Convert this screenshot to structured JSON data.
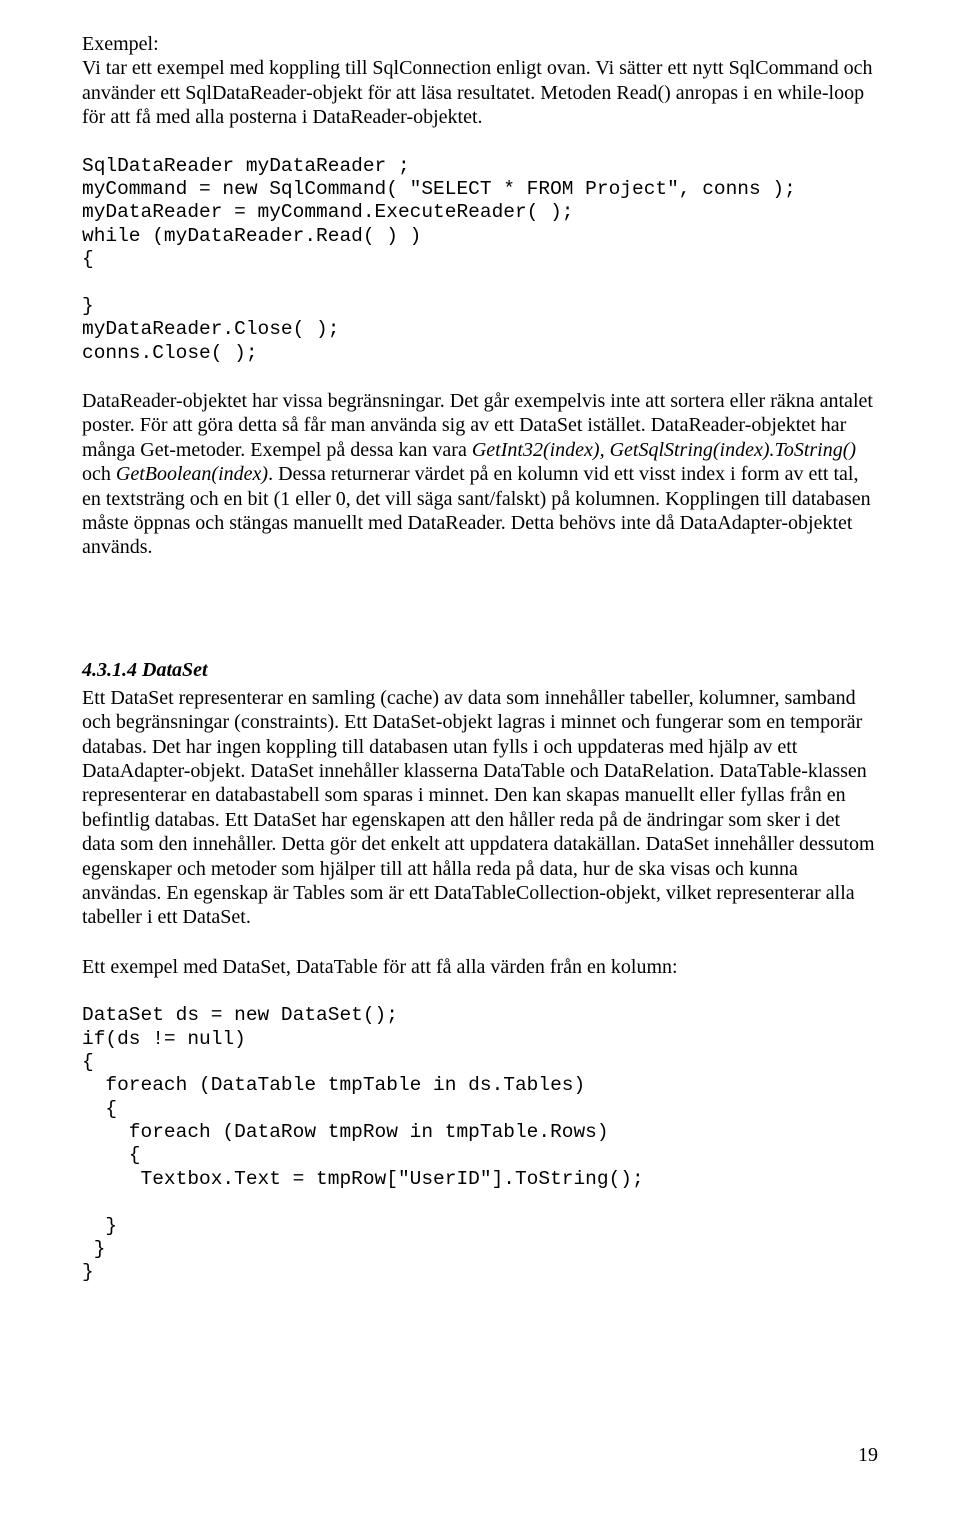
{
  "p1_label": "Exempel:",
  "p1_body": "Vi tar ett exempel med koppling till SqlConnection enligt ovan. Vi sätter ett nytt SqlCommand och använder ett SqlDataReader-objekt för att läsa resultatet. Metoden Read() anropas i en while-loop för att få med alla posterna i DataReader-objektet.",
  "code1": "SqlDataReader myDataReader ;\nmyCommand = new SqlCommand( \"SELECT * FROM Project\", conns );\nmyDataReader = myCommand.ExecuteReader( );\nwhile (myDataReader.Read( ) )\n{\n\n}\nmyDataReader.Close( );\nconns.Close( );",
  "p2_a": "DataReader-objektet har vissa begränsningar. Det går exempelvis inte att sortera eller räkna antalet poster. För att göra detta så får man använda sig av ett DataSet istället. DataReader-objektet har många Get-metoder. Exempel på dessa kan vara ",
  "p2_i1": "GetInt32(index), GetSqlString(index).ToString()",
  "p2_b": " och ",
  "p2_i2": "GetBoolean(index)",
  "p2_c": ". Dessa returnerar värdet på en kolumn vid ett visst index i form av ett tal, en textsträng och en bit (1 eller 0, det vill säga sant/falskt) på kolumnen. Kopplingen till databasen måste öppnas och stängas manuellt med DataReader. Detta behövs inte då DataAdapter-objektet används.",
  "h1": "4.3.1.4   DataSet",
  "p3": "Ett DataSet representerar en samling (cache) av data som innehåller tabeller, kolumner, samband och begränsningar (constraints). Ett DataSet-objekt lagras i minnet och fungerar som en temporär databas. Det har ingen koppling till databasen utan fylls i och uppdateras med hjälp av ett DataAdapter-objekt. DataSet innehåller klasserna DataTable och DataRelation. DataTable-klassen representerar en databastabell som sparas i minnet. Den kan skapas manuellt eller fyllas från en befintlig databas. Ett DataSet har egenskapen att den håller reda på de ändringar som sker i det data som den innehåller. Detta gör det enkelt att uppdatera datakällan. DataSet innehåller dessutom egenskaper och metoder som hjälper till att hålla reda på data, hur de ska visas och kunna användas. En egenskap är Tables som är ett DataTableCollection-objekt, vilket representerar alla tabeller i ett DataSet.",
  "p4": "Ett exempel med DataSet, DataTable för att få alla värden från en kolumn:",
  "code2": "DataSet ds = new DataSet();\nif(ds != null)\n{\n  foreach (DataTable tmpTable in ds.Tables)\n  {\n    foreach (DataRow tmpRow in tmpTable.Rows)\n    {\n     Textbox.Text = tmpRow[\"UserID\"].ToString();\n\n  }\n }\n}",
  "page_number": "19"
}
